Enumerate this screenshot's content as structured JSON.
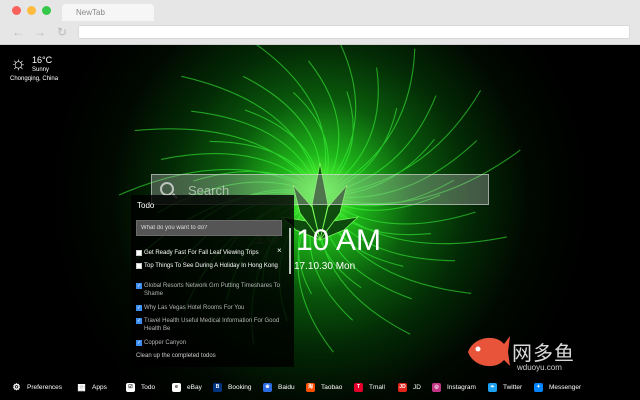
{
  "browser": {
    "tab_title": "NewTab",
    "nav": {
      "back_icon": "back-arrow-icon",
      "forward_icon": "forward-arrow-icon",
      "reload_icon": "reload-icon"
    },
    "address_value": ""
  },
  "weather": {
    "icon": "sun-icon",
    "temperature": "16°C",
    "condition": "Sunny",
    "location": "Chongqing,  China"
  },
  "search": {
    "placeholder": "Search"
  },
  "todo": {
    "title": "Todo",
    "input_placeholder": "What do you want to do?",
    "items": [
      {
        "label": "Get Ready Fast For Fall Leaf Viewing Trips",
        "checked": false
      },
      {
        "label": "Top Things To See During A Holiday In Hong Kong",
        "checked": false
      },
      {
        "label": "Global Resorts Network Grn Putting Timeshares To Shame",
        "checked": true
      },
      {
        "label": "Why Las Vegas Hotel Rooms For You",
        "checked": true
      },
      {
        "label": "Travel Health Useful Medical Information For Good Health Be",
        "checked": true
      },
      {
        "label": "Copper Canyon",
        "checked": true
      }
    ],
    "close_symbol": "×",
    "clean_label": "Clean up the completed todos"
  },
  "clock": {
    "ghost": "10",
    "time": "10 AM",
    "date": "17.10.30 Mon"
  },
  "watermark": {
    "text": "网多鱼",
    "url": "wduoyu.com"
  },
  "bottom_bar": [
    {
      "label": "Preferences",
      "icon": "gear-icon",
      "color": "#000000"
    },
    {
      "label": "Apps",
      "icon": "grid-icon",
      "color": "#000000"
    },
    {
      "label": "Todo",
      "icon": "checkbox-icon",
      "color": "#ffffff"
    },
    {
      "label": "eBay",
      "icon": "ebay-icon",
      "color": "#ffffff"
    },
    {
      "label": "Booking",
      "icon": "booking-icon",
      "color": "#003580"
    },
    {
      "label": "Baidu",
      "icon": "baidu-icon",
      "color": "#2d6be0"
    },
    {
      "label": "Taobao",
      "icon": "taobao-icon",
      "color": "#ff5000"
    },
    {
      "label": "Tmall",
      "icon": "tmall-icon",
      "color": "#e4002b"
    },
    {
      "label": "JD",
      "icon": "jd-icon",
      "color": "#e1251b"
    },
    {
      "label": "Instagram",
      "icon": "instagram-icon",
      "color": "#c13584"
    },
    {
      "label": "Twitter",
      "icon": "twitter-icon",
      "color": "#1da1f2"
    },
    {
      "label": "Messenger",
      "icon": "messenger-icon",
      "color": "#0084ff"
    }
  ]
}
